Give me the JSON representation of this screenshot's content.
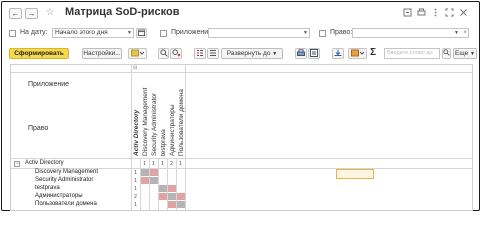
{
  "window": {
    "title": "Матрица SoD-рисков",
    "back_icon": "←",
    "forward_icon": "→",
    "star_icon": "☆",
    "icons": [
      "link-icon",
      "print-icon",
      "more-icon",
      "expand-icon",
      "close-icon"
    ]
  },
  "filters": {
    "date_label": "На дату:",
    "date_value": "Начало этого дня",
    "application_label": "Приложение:",
    "application_value": "",
    "right_label": "Право:",
    "right_value": ""
  },
  "toolbar": {
    "generate_label": "Сформировать",
    "settings_label": "Настройки...",
    "expand_label": "Развернуть до",
    "search_placeholder": "Введите слово до",
    "more_label": "Еще",
    "sum_icon": "Σ"
  },
  "matrix": {
    "header_application": "Приложение",
    "header_right": "Право",
    "columns": [
      "Activ Directory",
      "Discovery Management",
      "Security Administrator",
      "testprava",
      "Администраторы",
      "Пользователи домена"
    ],
    "group": {
      "name": "Activ Directory",
      "counts": [
        "",
        "1",
        "1",
        "1",
        "2",
        "1"
      ]
    },
    "rows": [
      {
        "name": "Discovery Management",
        "count": "1"
      },
      {
        "name": "Security Administrator",
        "count": "1"
      },
      {
        "name": "testprava",
        "count": "1"
      },
      {
        "name": "Администраторы",
        "count": "2"
      },
      {
        "name": "Пользователи домена",
        "count": "1"
      }
    ]
  },
  "colors": {
    "primary_button": "#f5d84c",
    "sod_conflict": "#e3a2a2",
    "diagonal": "#b4b4b4",
    "selection": "#e8b54a"
  }
}
